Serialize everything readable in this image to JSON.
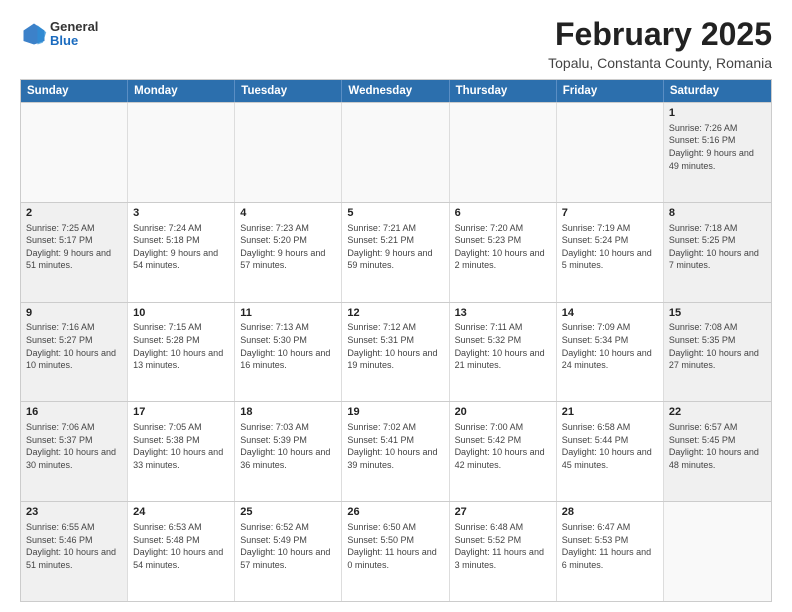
{
  "header": {
    "logo": {
      "general": "General",
      "blue": "Blue"
    },
    "title": "February 2025",
    "subtitle": "Topalu, Constanta County, Romania"
  },
  "calendar": {
    "weekdays": [
      "Sunday",
      "Monday",
      "Tuesday",
      "Wednesday",
      "Thursday",
      "Friday",
      "Saturday"
    ],
    "weeks": [
      [
        {
          "day": "",
          "info": "",
          "empty": true
        },
        {
          "day": "",
          "info": "",
          "empty": true
        },
        {
          "day": "",
          "info": "",
          "empty": true
        },
        {
          "day": "",
          "info": "",
          "empty": true
        },
        {
          "day": "",
          "info": "",
          "empty": true
        },
        {
          "day": "",
          "info": "",
          "empty": true
        },
        {
          "day": "1",
          "info": "Sunrise: 7:26 AM\nSunset: 5:16 PM\nDaylight: 9 hours and 49 minutes."
        }
      ],
      [
        {
          "day": "2",
          "info": "Sunrise: 7:25 AM\nSunset: 5:17 PM\nDaylight: 9 hours and 51 minutes."
        },
        {
          "day": "3",
          "info": "Sunrise: 7:24 AM\nSunset: 5:18 PM\nDaylight: 9 hours and 54 minutes."
        },
        {
          "day": "4",
          "info": "Sunrise: 7:23 AM\nSunset: 5:20 PM\nDaylight: 9 hours and 57 minutes."
        },
        {
          "day": "5",
          "info": "Sunrise: 7:21 AM\nSunset: 5:21 PM\nDaylight: 9 hours and 59 minutes."
        },
        {
          "day": "6",
          "info": "Sunrise: 7:20 AM\nSunset: 5:23 PM\nDaylight: 10 hours and 2 minutes."
        },
        {
          "day": "7",
          "info": "Sunrise: 7:19 AM\nSunset: 5:24 PM\nDaylight: 10 hours and 5 minutes."
        },
        {
          "day": "8",
          "info": "Sunrise: 7:18 AM\nSunset: 5:25 PM\nDaylight: 10 hours and 7 minutes."
        }
      ],
      [
        {
          "day": "9",
          "info": "Sunrise: 7:16 AM\nSunset: 5:27 PM\nDaylight: 10 hours and 10 minutes."
        },
        {
          "day": "10",
          "info": "Sunrise: 7:15 AM\nSunset: 5:28 PM\nDaylight: 10 hours and 13 minutes."
        },
        {
          "day": "11",
          "info": "Sunrise: 7:13 AM\nSunset: 5:30 PM\nDaylight: 10 hours and 16 minutes."
        },
        {
          "day": "12",
          "info": "Sunrise: 7:12 AM\nSunset: 5:31 PM\nDaylight: 10 hours and 19 minutes."
        },
        {
          "day": "13",
          "info": "Sunrise: 7:11 AM\nSunset: 5:32 PM\nDaylight: 10 hours and 21 minutes."
        },
        {
          "day": "14",
          "info": "Sunrise: 7:09 AM\nSunset: 5:34 PM\nDaylight: 10 hours and 24 minutes."
        },
        {
          "day": "15",
          "info": "Sunrise: 7:08 AM\nSunset: 5:35 PM\nDaylight: 10 hours and 27 minutes."
        }
      ],
      [
        {
          "day": "16",
          "info": "Sunrise: 7:06 AM\nSunset: 5:37 PM\nDaylight: 10 hours and 30 minutes."
        },
        {
          "day": "17",
          "info": "Sunrise: 7:05 AM\nSunset: 5:38 PM\nDaylight: 10 hours and 33 minutes."
        },
        {
          "day": "18",
          "info": "Sunrise: 7:03 AM\nSunset: 5:39 PM\nDaylight: 10 hours and 36 minutes."
        },
        {
          "day": "19",
          "info": "Sunrise: 7:02 AM\nSunset: 5:41 PM\nDaylight: 10 hours and 39 minutes."
        },
        {
          "day": "20",
          "info": "Sunrise: 7:00 AM\nSunset: 5:42 PM\nDaylight: 10 hours and 42 minutes."
        },
        {
          "day": "21",
          "info": "Sunrise: 6:58 AM\nSunset: 5:44 PM\nDaylight: 10 hours and 45 minutes."
        },
        {
          "day": "22",
          "info": "Sunrise: 6:57 AM\nSunset: 5:45 PM\nDaylight: 10 hours and 48 minutes."
        }
      ],
      [
        {
          "day": "23",
          "info": "Sunrise: 6:55 AM\nSunset: 5:46 PM\nDaylight: 10 hours and 51 minutes."
        },
        {
          "day": "24",
          "info": "Sunrise: 6:53 AM\nSunset: 5:48 PM\nDaylight: 10 hours and 54 minutes."
        },
        {
          "day": "25",
          "info": "Sunrise: 6:52 AM\nSunset: 5:49 PM\nDaylight: 10 hours and 57 minutes."
        },
        {
          "day": "26",
          "info": "Sunrise: 6:50 AM\nSunset: 5:50 PM\nDaylight: 11 hours and 0 minutes."
        },
        {
          "day": "27",
          "info": "Sunrise: 6:48 AM\nSunset: 5:52 PM\nDaylight: 11 hours and 3 minutes."
        },
        {
          "day": "28",
          "info": "Sunrise: 6:47 AM\nSunset: 5:53 PM\nDaylight: 11 hours and 6 minutes."
        },
        {
          "day": "",
          "info": "",
          "empty": true
        }
      ]
    ]
  }
}
